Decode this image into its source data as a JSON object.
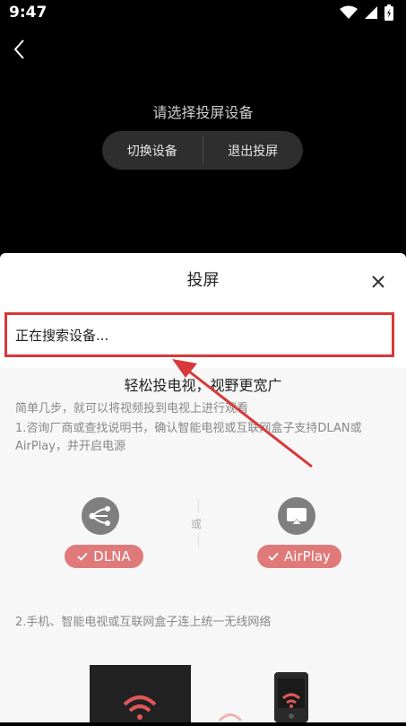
{
  "status_bar": {
    "time": "9:47"
  },
  "top": {
    "prompt": "请选择投屏设备",
    "switch_device_label": "切换设备",
    "exit_cast_label": "退出投屏"
  },
  "sheet": {
    "title": "投屏",
    "searching_text": "正在搜索设备...",
    "guide_title": "轻松投电视，视野更宽广",
    "guide_subtitle": "简单几步，就可以将视频投到电视上进行观看",
    "step1": "1.咨询厂商或查找说明书，确认智能电视或互联网盒子支持DLAN或AirPlay，并开启电源",
    "or_text": "或",
    "dlna_label": "DLNA",
    "airplay_label": "AirPlay",
    "step2": "2.手机、智能电视或互联网盒子连上统一无线网络"
  },
  "colors": {
    "accent_red": "#d83838",
    "pill_red": "#e07a7a",
    "dark_bg": "#000000"
  },
  "icons": [
    "back-icon",
    "wifi-icon",
    "cellular-icon",
    "battery-icon",
    "close-icon",
    "share-icon",
    "airplay-icon",
    "check-icon",
    "wifi-signal-icon"
  ]
}
